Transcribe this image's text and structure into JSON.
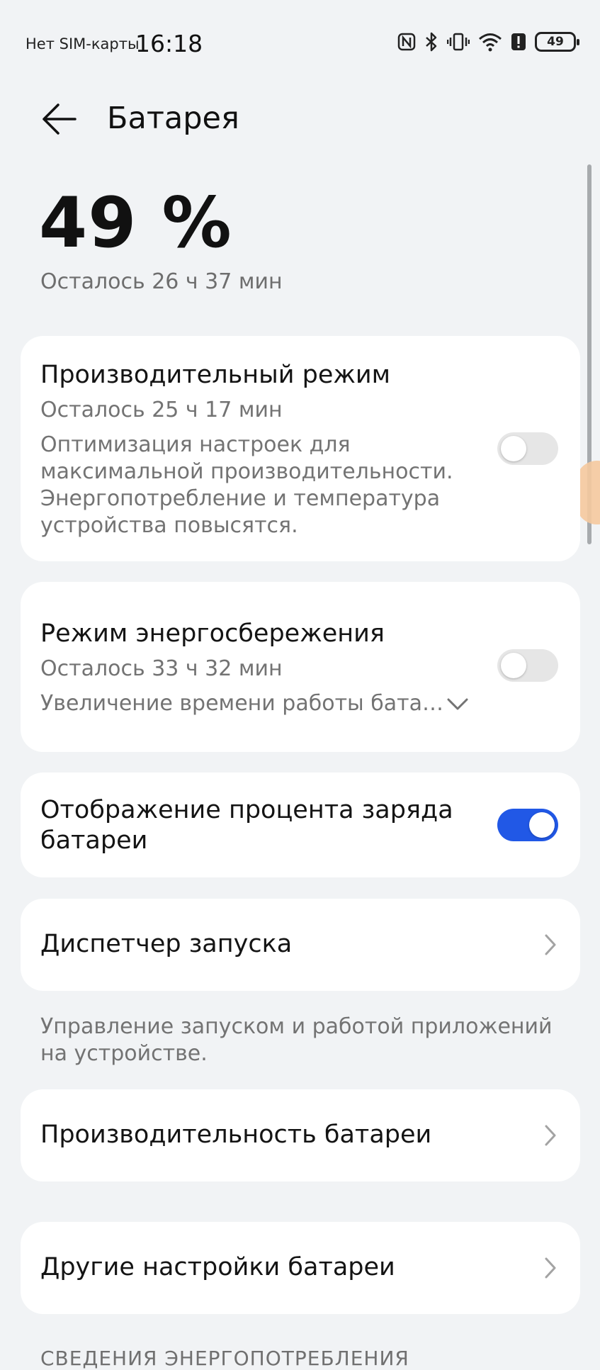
{
  "status_bar": {
    "carrier": "Нет SIM-карты",
    "time": "16:18",
    "battery_level": "49",
    "icons": [
      "nfc-icon",
      "bluetooth-icon",
      "vibrate-icon",
      "wifi-icon",
      "battery-alert-icon",
      "battery-icon"
    ]
  },
  "header": {
    "title": "Батарея",
    "back_icon": "arrow-left-icon"
  },
  "battery": {
    "percent": "49 %",
    "remaining": "Осталось 26 ч 37 мин"
  },
  "performance_mode": {
    "title": "Производительный режим",
    "remaining": "Осталось 25 ч 17 мин",
    "description_lines": [
      "Оптимизация настроек для",
      "максимальной производительности.",
      "Энергопотребление и температура",
      "устройства повысятся."
    ],
    "enabled": false
  },
  "power_saving": {
    "title": "Режим энергосбережения",
    "remaining": "Осталось 33 ч 32 мин",
    "description": "Увеличение времени работы бата…",
    "enabled": false
  },
  "show_percentage": {
    "title_lines": [
      "Отображение процента заряда",
      "батареи"
    ],
    "enabled": true
  },
  "launch_manager": {
    "title": "Диспетчер запуска",
    "note_lines": [
      "Управление запуском и работой приложений",
      "на устройстве."
    ]
  },
  "battery_performance": {
    "title": "Производительность батареи"
  },
  "other_settings": {
    "title": "Другие настройки батареи"
  },
  "section_header": "СВЕДЕНИЯ ЭНЕРГОПОТРЕБЛЕНИЯ",
  "colors": {
    "accent": "#2158e6",
    "background": "#f1f3f5",
    "card": "#ffffff",
    "secondary_text": "#737373"
  }
}
